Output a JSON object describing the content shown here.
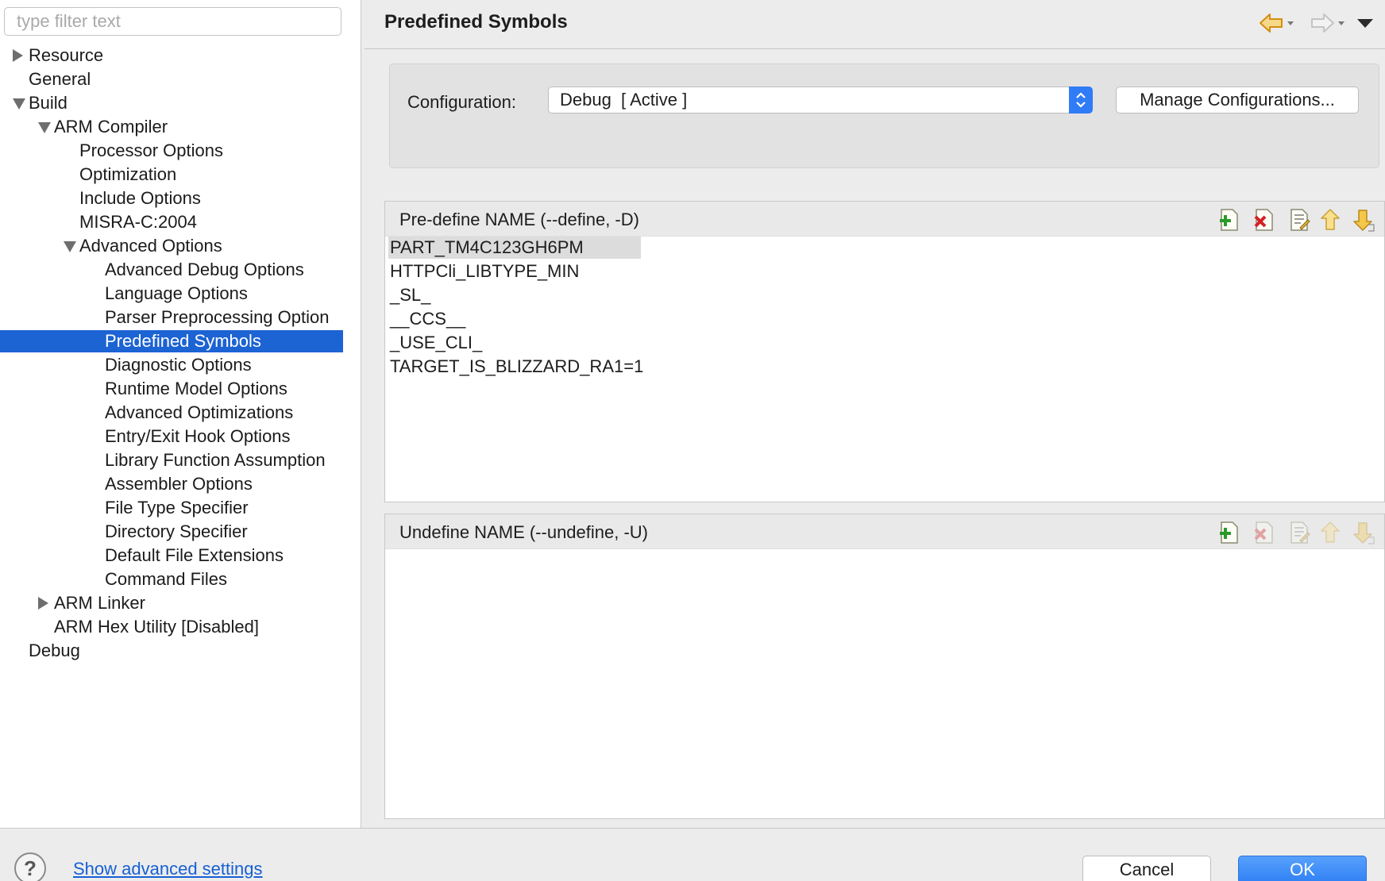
{
  "filter": {
    "placeholder": "type filter text",
    "value": ""
  },
  "tree": {
    "items": [
      {
        "label": "Resource",
        "level": 0,
        "twisty": "collapsed"
      },
      {
        "label": "General",
        "level": 0,
        "twisty": "none"
      },
      {
        "label": "Build",
        "level": 0,
        "twisty": "expanded"
      },
      {
        "label": "ARM Compiler",
        "level": 1,
        "twisty": "expanded"
      },
      {
        "label": "Processor Options",
        "level": 2,
        "twisty": "none"
      },
      {
        "label": "Optimization",
        "level": 2,
        "twisty": "none"
      },
      {
        "label": "Include Options",
        "level": 2,
        "twisty": "none"
      },
      {
        "label": "MISRA-C:2004",
        "level": 2,
        "twisty": "none"
      },
      {
        "label": "Advanced Options",
        "level": 2,
        "twisty": "expanded"
      },
      {
        "label": "Advanced Debug Options",
        "level": 3,
        "twisty": "none"
      },
      {
        "label": "Language Options",
        "level": 3,
        "twisty": "none"
      },
      {
        "label": "Parser Preprocessing Option",
        "level": 3,
        "twisty": "none"
      },
      {
        "label": "Predefined Symbols",
        "level": 3,
        "twisty": "none",
        "selected": true
      },
      {
        "label": "Diagnostic Options",
        "level": 3,
        "twisty": "none"
      },
      {
        "label": "Runtime Model Options",
        "level": 3,
        "twisty": "none"
      },
      {
        "label": "Advanced Optimizations",
        "level": 3,
        "twisty": "none"
      },
      {
        "label": "Entry/Exit Hook Options",
        "level": 3,
        "twisty": "none"
      },
      {
        "label": "Library Function Assumption",
        "level": 3,
        "twisty": "none"
      },
      {
        "label": "Assembler Options",
        "level": 3,
        "twisty": "none"
      },
      {
        "label": "File Type Specifier",
        "level": 3,
        "twisty": "none"
      },
      {
        "label": "Directory Specifier",
        "level": 3,
        "twisty": "none"
      },
      {
        "label": "Default File Extensions",
        "level": 3,
        "twisty": "none"
      },
      {
        "label": "Command Files",
        "level": 3,
        "twisty": "none"
      },
      {
        "label": "ARM Linker",
        "level": 1,
        "twisty": "collapsed"
      },
      {
        "label": "ARM Hex Utility  [Disabled]",
        "level": 1,
        "twisty": "none"
      },
      {
        "label": "Debug",
        "level": 0,
        "twisty": "none"
      }
    ]
  },
  "header": {
    "title": "Predefined Symbols",
    "back_icon": "back-arrow-icon",
    "forward_icon": "forward-arrow-icon",
    "menu_icon": "view-menu-icon"
  },
  "config": {
    "label": "Configuration:",
    "selected": "Debug  [ Active ]",
    "manage_label": "Manage Configurations..."
  },
  "predefine": {
    "title": "Pre-define NAME (--define, -D)",
    "items": [
      "PART_TM4C123GH6PM",
      "HTTPCli_LIBTYPE_MIN",
      "_SL_",
      "__CCS__",
      "_USE_CLI_",
      "TARGET_IS_BLIZZARD_RA1=1"
    ],
    "tools": [
      "add-icon",
      "delete-icon",
      "edit-icon",
      "move-up-icon",
      "move-down-icon"
    ]
  },
  "undefine": {
    "title": "Undefine NAME (--undefine, -U)",
    "items": [],
    "tools": [
      "add-icon",
      "delete-icon",
      "edit-icon",
      "move-up-icon",
      "move-down-icon"
    ]
  },
  "footer": {
    "help": "?",
    "advanced_link": "Show advanced settings",
    "cancel": "Cancel",
    "ok": "OK"
  },
  "colors": {
    "selection": "#1c63d3",
    "ok_button": "#2f80f5",
    "link": "#1660d4",
    "nav_arrow": "#e8a21a"
  }
}
